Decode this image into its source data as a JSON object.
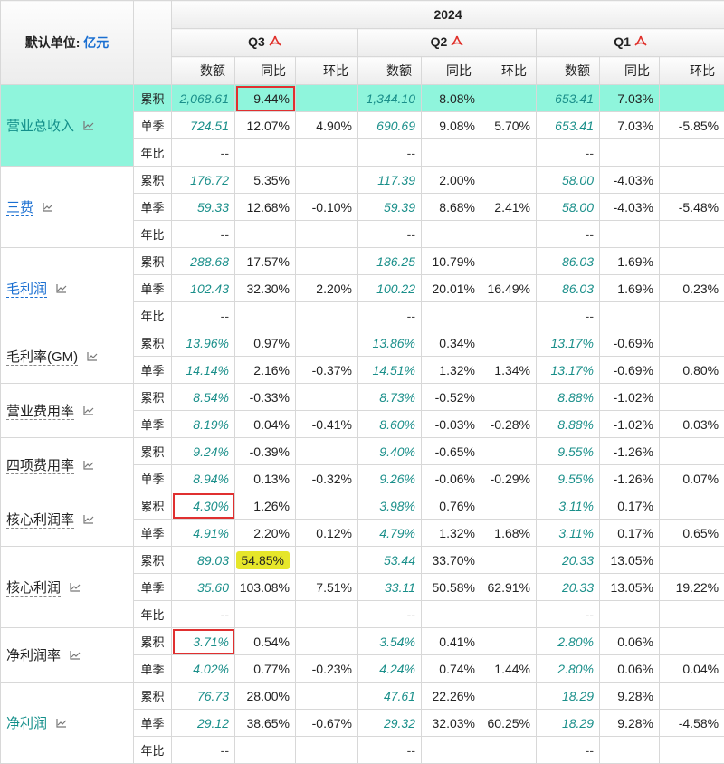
{
  "header": {
    "unit_label": "默认单位:",
    "unit_value": "亿元",
    "year": "2024",
    "quarters": [
      "Q3",
      "Q2",
      "Q1"
    ],
    "columns": [
      "数额",
      "同比",
      "环比"
    ]
  },
  "row_types": {
    "cum": "累积",
    "sq": "单季",
    "yoy": "年比"
  },
  "dash": "--",
  "metrics": [
    {
      "name": "营业总收入",
      "cum": [
        [
          "2,068.61",
          "9.44%",
          ""
        ],
        [
          "1,344.10",
          "8.08%",
          ""
        ],
        [
          "653.41",
          "7.03%",
          ""
        ]
      ],
      "sq": [
        [
          "724.51",
          "12.07%",
          "4.90%"
        ],
        [
          "690.69",
          "9.08%",
          "5.70%"
        ],
        [
          "653.41",
          "7.03%",
          "-5.85%"
        ]
      ]
    },
    {
      "name": "三费",
      "cum": [
        [
          "176.72",
          "5.35%",
          ""
        ],
        [
          "117.39",
          "2.00%",
          ""
        ],
        [
          "58.00",
          "-4.03%",
          ""
        ]
      ],
      "sq": [
        [
          "59.33",
          "12.68%",
          "-0.10%"
        ],
        [
          "59.39",
          "8.68%",
          "2.41%"
        ],
        [
          "58.00",
          "-4.03%",
          "-5.48%"
        ]
      ]
    },
    {
      "name": "毛利润",
      "cum": [
        [
          "288.68",
          "17.57%",
          ""
        ],
        [
          "186.25",
          "10.79%",
          ""
        ],
        [
          "86.03",
          "1.69%",
          ""
        ]
      ],
      "sq": [
        [
          "102.43",
          "32.30%",
          "2.20%"
        ],
        [
          "100.22",
          "20.01%",
          "16.49%"
        ],
        [
          "86.03",
          "1.69%",
          "0.23%"
        ]
      ]
    },
    {
      "name": "毛利率(GM)",
      "cum": [
        [
          "13.96%",
          "0.97%",
          ""
        ],
        [
          "13.86%",
          "0.34%",
          ""
        ],
        [
          "13.17%",
          "-0.69%",
          ""
        ]
      ],
      "sq": [
        [
          "14.14%",
          "2.16%",
          "-0.37%"
        ],
        [
          "14.51%",
          "1.32%",
          "1.34%"
        ],
        [
          "13.17%",
          "-0.69%",
          "0.80%"
        ]
      ]
    },
    {
      "name": "营业费用率",
      "cum": [
        [
          "8.54%",
          "-0.33%",
          ""
        ],
        [
          "8.73%",
          "-0.52%",
          ""
        ],
        [
          "8.88%",
          "-1.02%",
          ""
        ]
      ],
      "sq": [
        [
          "8.19%",
          "0.04%",
          "-0.41%"
        ],
        [
          "8.60%",
          "-0.03%",
          "-0.28%"
        ],
        [
          "8.88%",
          "-1.02%",
          "0.03%"
        ]
      ]
    },
    {
      "name": "四项费用率",
      "cum": [
        [
          "9.24%",
          "-0.39%",
          ""
        ],
        [
          "9.40%",
          "-0.65%",
          ""
        ],
        [
          "9.55%",
          "-1.26%",
          ""
        ]
      ],
      "sq": [
        [
          "8.94%",
          "0.13%",
          "-0.32%"
        ],
        [
          "9.26%",
          "-0.06%",
          "-0.29%"
        ],
        [
          "9.55%",
          "-1.26%",
          "0.07%"
        ]
      ]
    },
    {
      "name": "核心利润率",
      "cum": [
        [
          "4.30%",
          "1.26%",
          ""
        ],
        [
          "3.98%",
          "0.76%",
          ""
        ],
        [
          "3.11%",
          "0.17%",
          ""
        ]
      ],
      "sq": [
        [
          "4.91%",
          "2.20%",
          "0.12%"
        ],
        [
          "4.79%",
          "1.32%",
          "1.68%"
        ],
        [
          "3.11%",
          "0.17%",
          "0.65%"
        ]
      ]
    },
    {
      "name": "核心利润",
      "cum": [
        [
          "89.03",
          "54.85%",
          ""
        ],
        [
          "53.44",
          "33.70%",
          ""
        ],
        [
          "20.33",
          "13.05%",
          ""
        ]
      ],
      "sq": [
        [
          "35.60",
          "103.08%",
          "7.51%"
        ],
        [
          "33.11",
          "50.58%",
          "62.91%"
        ],
        [
          "20.33",
          "13.05%",
          "19.22%"
        ]
      ]
    },
    {
      "name": "净利润率",
      "cum": [
        [
          "3.71%",
          "0.54%",
          ""
        ],
        [
          "3.54%",
          "0.41%",
          ""
        ],
        [
          "2.80%",
          "0.06%",
          ""
        ]
      ],
      "sq": [
        [
          "4.02%",
          "0.77%",
          "-0.23%"
        ],
        [
          "4.24%",
          "0.74%",
          "1.44%"
        ],
        [
          "2.80%",
          "0.06%",
          "0.04%"
        ]
      ]
    },
    {
      "name": "净利润",
      "cum": [
        [
          "76.73",
          "28.00%",
          ""
        ],
        [
          "47.61",
          "22.26%",
          ""
        ],
        [
          "18.29",
          "9.28%",
          ""
        ]
      ],
      "sq": [
        [
          "29.12",
          "38.65%",
          "-0.67%"
        ],
        [
          "29.32",
          "32.03%",
          "60.25%"
        ],
        [
          "18.29",
          "9.28%",
          "-4.58%"
        ]
      ]
    }
  ],
  "colors": {
    "highlight_row": "#8ff5dc",
    "teal_value": "#1a8f8a",
    "link_blue": "#1a6fd1",
    "red_box": "#e03030",
    "yellow_mark": "#e6e62a"
  }
}
